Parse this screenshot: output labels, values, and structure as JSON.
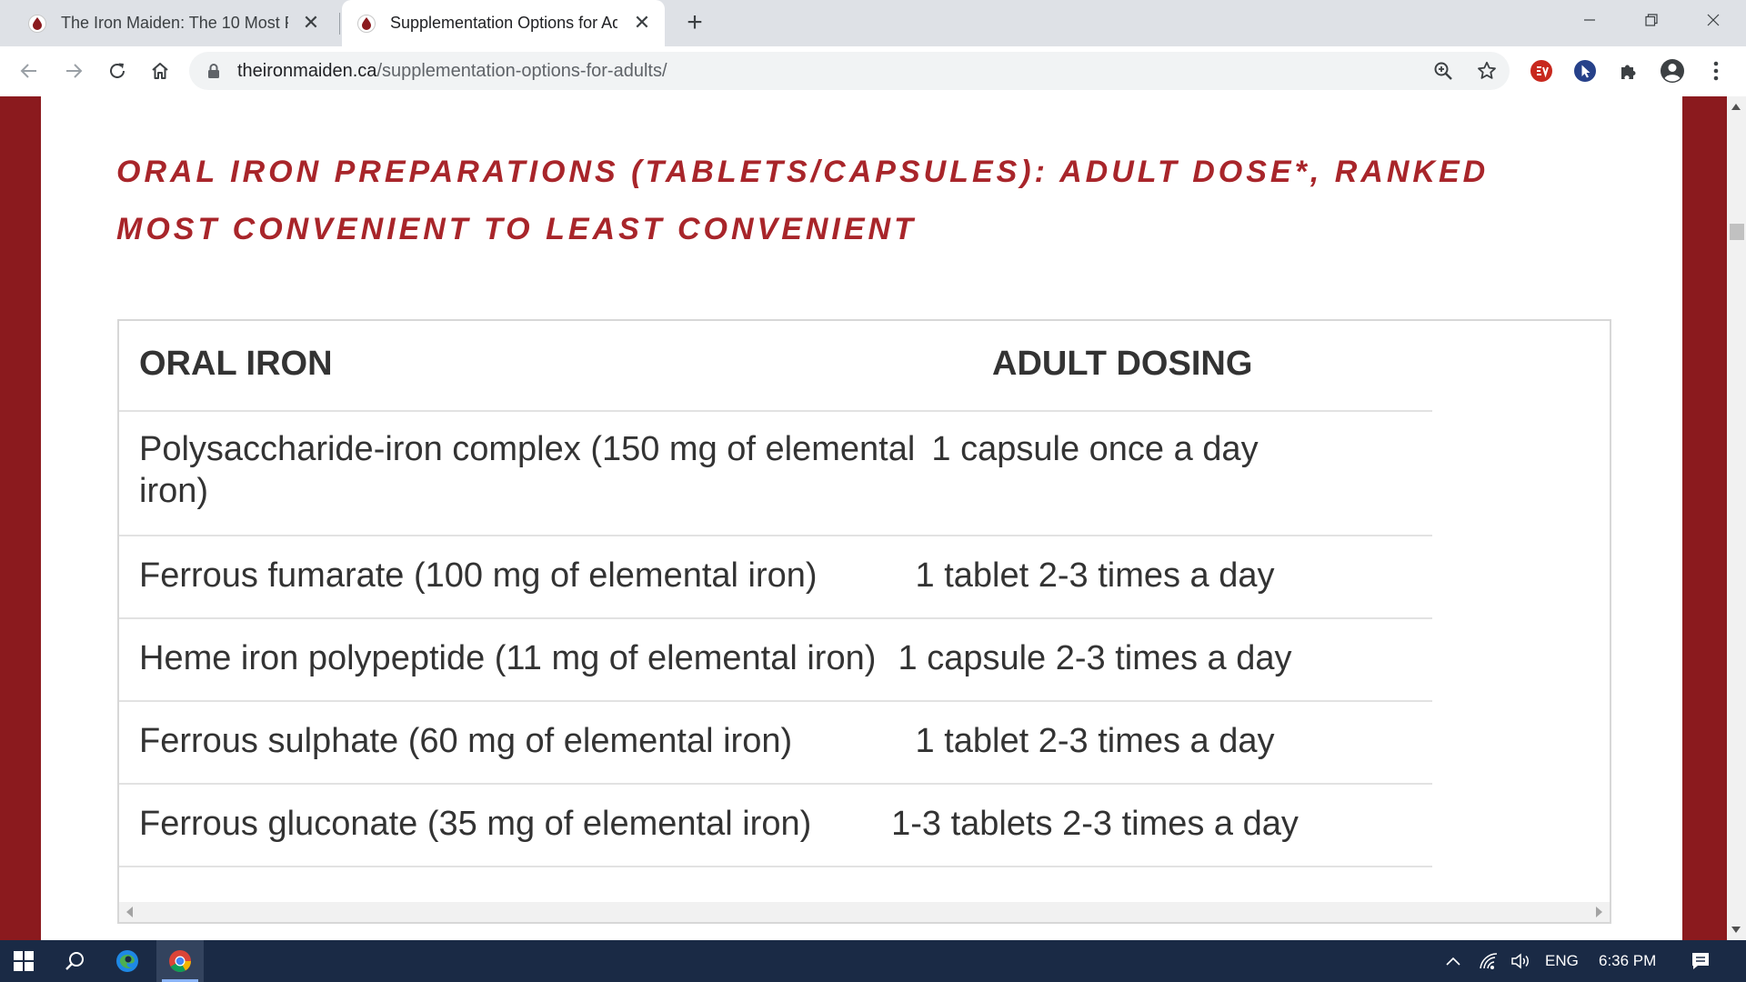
{
  "browser": {
    "tabs": [
      {
        "title": "The Iron Maiden: The 10 Most Po",
        "active": false
      },
      {
        "title": "Supplementation Options for Ad",
        "active": true
      }
    ],
    "url_host": "theironmaiden.ca",
    "url_path": "/supplementation-options-for-adults/"
  },
  "page": {
    "heading": "ORAL IRON PREPARATIONS (TABLETS/CAPSULES): ADULT DOSE*, RANKED MOST CONVENIENT TO LEAST CONVENIENT",
    "table": {
      "headers": [
        "ORAL IRON",
        "ADULT DOSING"
      ],
      "rows": [
        {
          "iron": "Polysaccharide-iron complex (150 mg of elemental iron)",
          "dosing": "1 capsule once a day"
        },
        {
          "iron": "Ferrous fumarate (100 mg of elemental iron)",
          "dosing": "1 tablet 2-3 times a day"
        },
        {
          "iron": "Heme iron polypeptide (11 mg of elemental iron)",
          "dosing": "1 capsule 2-3 times a day"
        },
        {
          "iron": "Ferrous sulphate (60 mg of elemental iron)",
          "dosing": "1 tablet 2-3 times a day"
        },
        {
          "iron": "Ferrous gluconate (35 mg of elemental iron)",
          "dosing": "1-3 tablets 2-3 times a day"
        }
      ]
    }
  },
  "taskbar": {
    "language": "ENG",
    "time": "6:36 PM"
  },
  "colors": {
    "brand_red": "#8b1a1e",
    "heading_red": "#a8252a",
    "taskbar": "#1a2a45"
  }
}
